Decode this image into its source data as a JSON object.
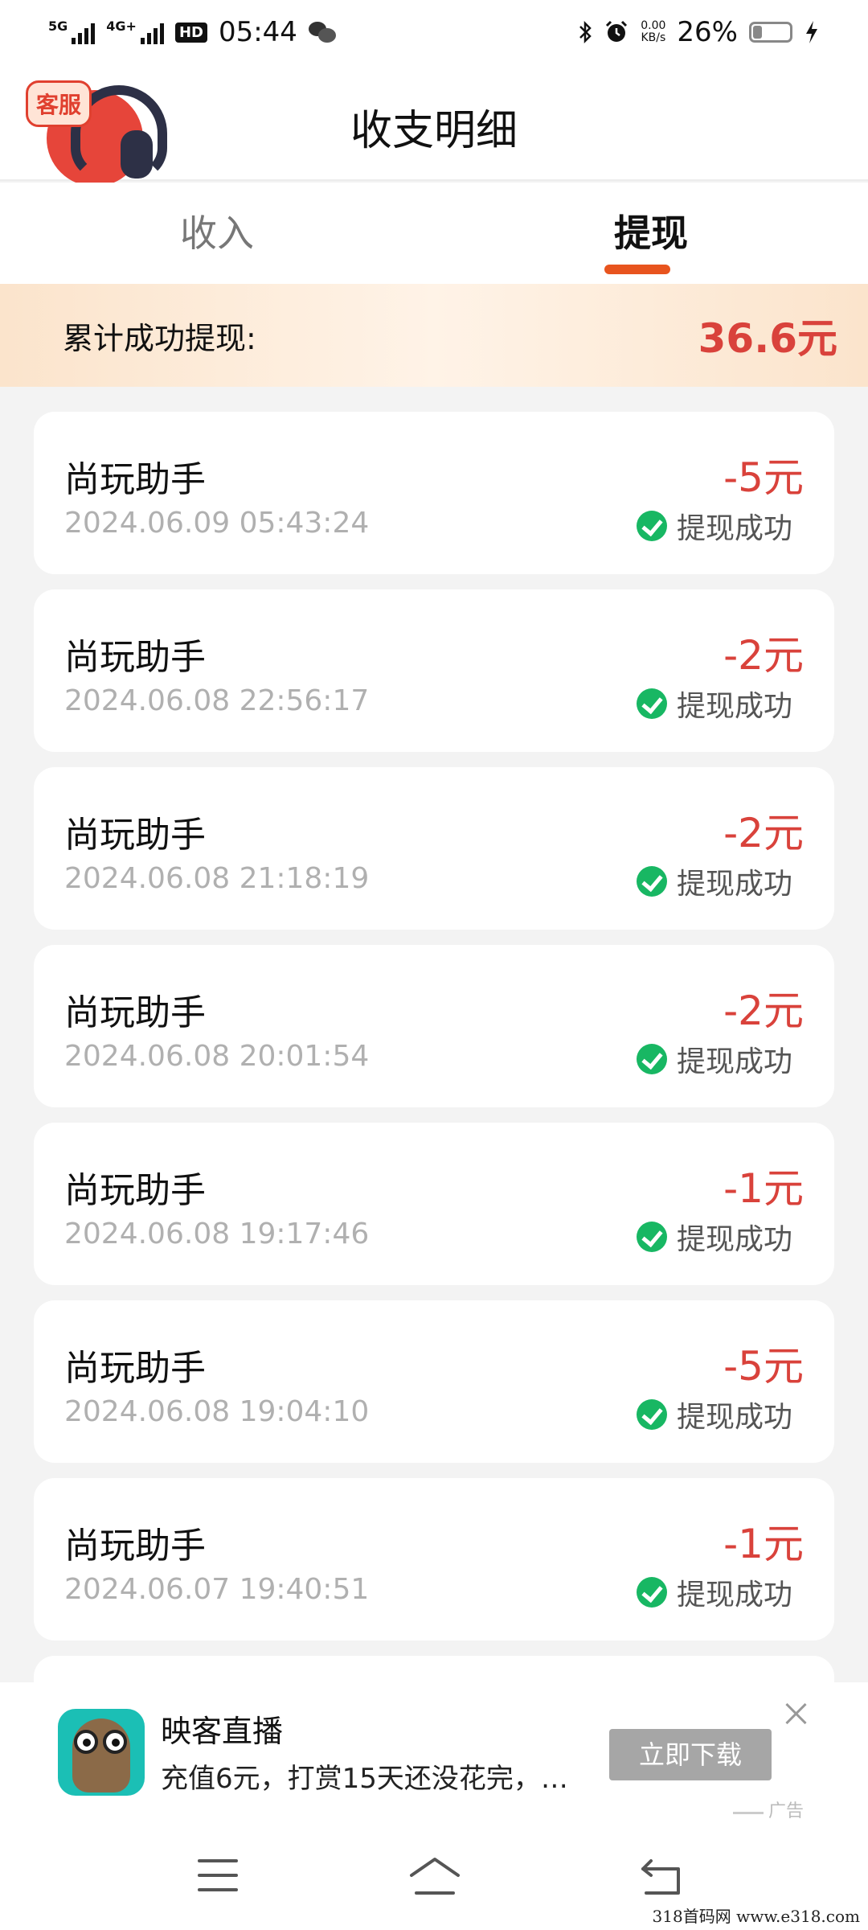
{
  "status_bar": {
    "signal1": "5G",
    "signal2": "4G+",
    "hd": "HD",
    "time": "05:44",
    "speed_value": "0.00",
    "speed_unit": "KB/s",
    "battery": "26%",
    "battery_level": 0.26
  },
  "header": {
    "title": "收支明细",
    "service_badge": "客服"
  },
  "tabs": [
    {
      "label": "收入",
      "active": false
    },
    {
      "label": "提现",
      "active": true
    }
  ],
  "summary": {
    "label": "累计成功提现:",
    "value": "36.6元"
  },
  "records": [
    {
      "name": "尚玩助手",
      "time": "2024.06.09 05:43:24",
      "amount": "-5元",
      "status": "提现成功"
    },
    {
      "name": "尚玩助手",
      "time": "2024.06.08 22:56:17",
      "amount": "-2元",
      "status": "提现成功"
    },
    {
      "name": "尚玩助手",
      "time": "2024.06.08 21:18:19",
      "amount": "-2元",
      "status": "提现成功"
    },
    {
      "name": "尚玩助手",
      "time": "2024.06.08 20:01:54",
      "amount": "-2元",
      "status": "提现成功"
    },
    {
      "name": "尚玩助手",
      "time": "2024.06.08 19:17:46",
      "amount": "-1元",
      "status": "提现成功"
    },
    {
      "name": "尚玩助手",
      "time": "2024.06.08 19:04:10",
      "amount": "-5元",
      "status": "提现成功"
    },
    {
      "name": "尚玩助手",
      "time": "2024.06.07 19:40:51",
      "amount": "-1元",
      "status": "提现成功"
    }
  ],
  "ad": {
    "title": "映客直播",
    "description": "充值6元，打赏15天还没花完，…",
    "button": "立即下载",
    "label": "广告"
  },
  "watermark": "318首码网  www.e318.com",
  "colors": {
    "accent": "#e8541e",
    "amount": "#d9423b",
    "success": "#18b763"
  }
}
